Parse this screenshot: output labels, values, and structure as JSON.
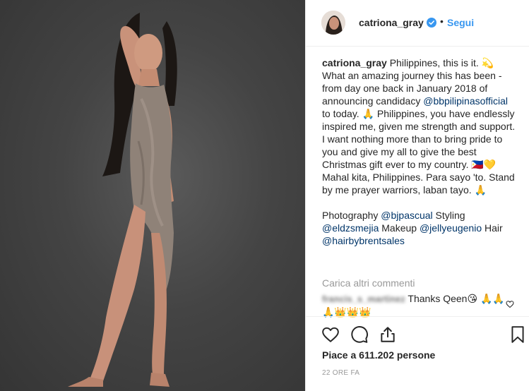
{
  "post": {
    "username": "catriona_gray",
    "follow_label": "Segui",
    "dot": "•"
  },
  "caption": {
    "username": "catriona_gray",
    "text_1": " Philippines, this is it. 💫 What an amazing journey this has been - from day one back in January 2018 of announcing candidacy ",
    "mention_1": "@bbpilipinasofficial",
    "text_2": " to today. 🙏 Philippines, you have endlessly inspired me, given me strength and support. I want nothing more than to bring pride to you and give my all to give the best Christmas gift ever to my country. 🇵🇭💛 Mahal kita, Philippines. Para sayo 'to. Stand by me prayer warriors, laban tayo. 🙏",
    "credit_1": "Photography ",
    "mention_2": "@bjpascual",
    "credit_2": " Styling ",
    "mention_3": "@eldzsmejia",
    "credit_3": " Makeup ",
    "mention_4": "@jellyeugenio",
    "credit_4": " Hair ",
    "mention_5": "@hairbybrentsales"
  },
  "comments": {
    "load_more": "Carica altri commenti",
    "items": [
      {
        "username": "francis_s_martinez",
        "text": " Thanks Qeen😘 🙏🙏🙏👑👑👑"
      }
    ]
  },
  "stats": {
    "likes": "Piace a 611.202 persone",
    "time": "22 ORE FA"
  },
  "icons": {
    "like": "heart-icon",
    "comment": "comment-icon",
    "share": "share-icon",
    "save": "bookmark-icon",
    "verified": "verified-badge-icon"
  },
  "colors": {
    "accent": "#3897f0",
    "verified": "#3897f0",
    "link": "#003569",
    "muted": "#999999"
  }
}
